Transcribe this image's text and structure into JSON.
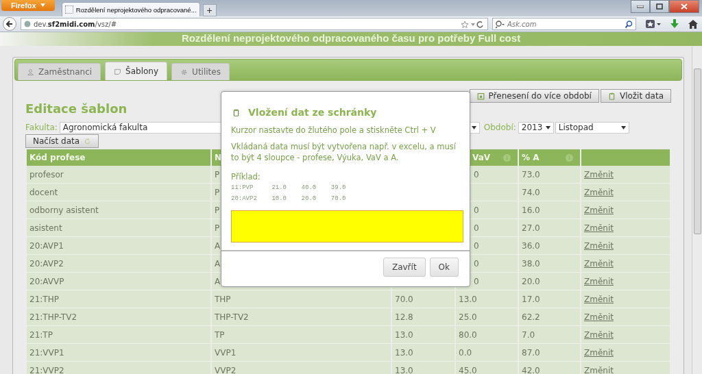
{
  "browser": {
    "menu_button": "Firefox",
    "tab_title": "Rozdělení neprojektového odpracované...",
    "new_tab": "+",
    "url": "dev.**sf2midi.com**/vsz/#",
    "search_placeholder": "Ask.com"
  },
  "banner": {
    "title": "Rozdělení neprojektového odpracovaného času pro potřeby Full cost"
  },
  "tabs": [
    {
      "label": "Zaměstnanci",
      "selected": false
    },
    {
      "label": "Šablony",
      "selected": true
    },
    {
      "label": "Utilites",
      "selected": false
    }
  ],
  "toolbar_buttons": [
    "Přenesení do více období",
    "Vložit data"
  ],
  "heading": "Editace šablon",
  "filters": {
    "faculty_label": "Fakulta:",
    "faculty_value": "Agronomická fakulta",
    "period_label": "Období:",
    "year": "2013",
    "month": "Listopad"
  },
  "load_button": "Načíst data",
  "table": {
    "header": {
      "code": "Kód profese",
      "name": "N",
      "vav": "VaV",
      "a": "% A"
    },
    "rows": [
      {
        "code": "profesor",
        "name": "P",
        "vav": "0",
        "a": "73.0",
        "action": "Změnit"
      },
      {
        "code": "docent",
        "name": "P",
        "a": "74.0",
        "action": "Změnit"
      },
      {
        "code": "odborny asistent",
        "name": "P",
        "vav": "0",
        "a": "16.0",
        "action": "Změnit"
      },
      {
        "code": "asistent",
        "name": "P",
        "vav": "0",
        "a": "27.0",
        "action": "Změnit"
      },
      {
        "code": "20:AVP1",
        "name": "A",
        "vav": "0",
        "a": "36.0",
        "action": "Změnit"
      },
      {
        "code": "20:AVP2",
        "name": "A",
        "vav": "0",
        "a": "38.0",
        "action": "Změnit"
      },
      {
        "code": "20:AVVP",
        "name": "A",
        "vav": "0",
        "a": "20.0",
        "action": "Změnit"
      },
      {
        "code": "21:THP",
        "name": "THP",
        "teaching": "70.0",
        "vav": "13.0",
        "a": "17.0",
        "action": "Změnit"
      },
      {
        "code": "21:THP-TV2",
        "name": "THP-TV2",
        "teaching": "12.8",
        "vav": "25.0",
        "a": "62.2",
        "action": "Změnit"
      },
      {
        "code": "21:TP",
        "name": "TP",
        "teaching": "13.0",
        "vav": "80.0",
        "a": "7.0",
        "action": "Změnit"
      },
      {
        "code": "21:VVP1",
        "name": "VVP1",
        "teaching": "13.0",
        "vav": "0.0",
        "a": "87.0",
        "action": "Změnit"
      },
      {
        "code": "21:VVP2",
        "name": "VVP2",
        "teaching": "13.0",
        "vav": "45.0",
        "a": "42.0",
        "action": "Změnit"
      }
    ]
  },
  "dialog": {
    "title": "Vložení dat ze schránky",
    "instruction": "Kurzor nastavte do žlutého pole a stiskněte Ctrl + V",
    "note": "Vkládaná data musí být vytvořena např. v excelu, a musí to být 4 sloupce - profese, Výuka, VaV a A.",
    "example_label": "Příklad:",
    "example_lines": [
      "11:PVP     21.0    40.0    39.0",
      "20:AVP2    10.0    20.0    70.0"
    ],
    "buttons": [
      "Zavřít",
      "Ok"
    ]
  }
}
